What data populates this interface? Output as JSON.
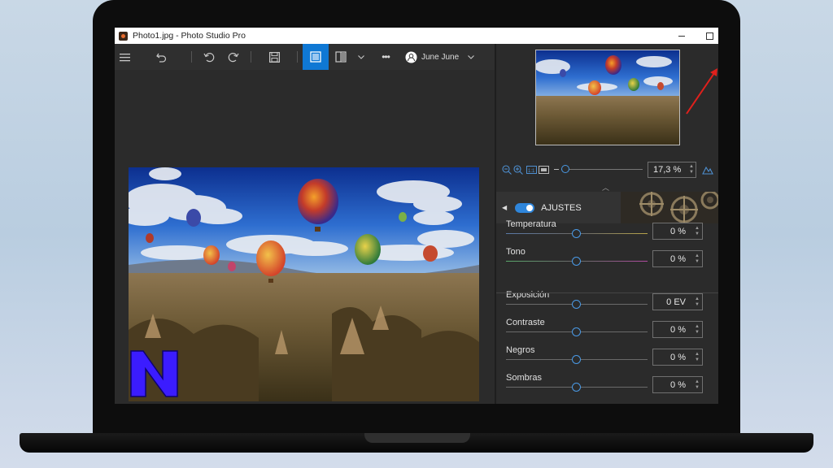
{
  "window": {
    "title": "Photo1.jpg - Photo Studio Pro"
  },
  "toolbar": {
    "user_name": "June June",
    "more": "•••"
  },
  "zoom": {
    "value": "17,3 %"
  },
  "section": {
    "title": "AJUSTES"
  },
  "adjustments": [
    {
      "label": "Temperatura",
      "value": "0 %",
      "level": 0.5
    },
    {
      "label": "Tono",
      "value": "0 %",
      "level": 0.5
    },
    {
      "label": "Exposición",
      "value": "0 EV",
      "level": 0.5
    },
    {
      "label": "Contraste",
      "value": "0 %",
      "level": 0.5
    },
    {
      "label": "Negros",
      "value": "0 %",
      "level": 0.5
    },
    {
      "label": "Sombras",
      "value": "0 %",
      "level": 0.5
    }
  ],
  "colors": {
    "accent": "#0f78d4",
    "toggle": "#2f86db",
    "watermark": "#3b1cff",
    "annotation_arrow": "#e0201c"
  },
  "watermark": {
    "letter": "N"
  }
}
